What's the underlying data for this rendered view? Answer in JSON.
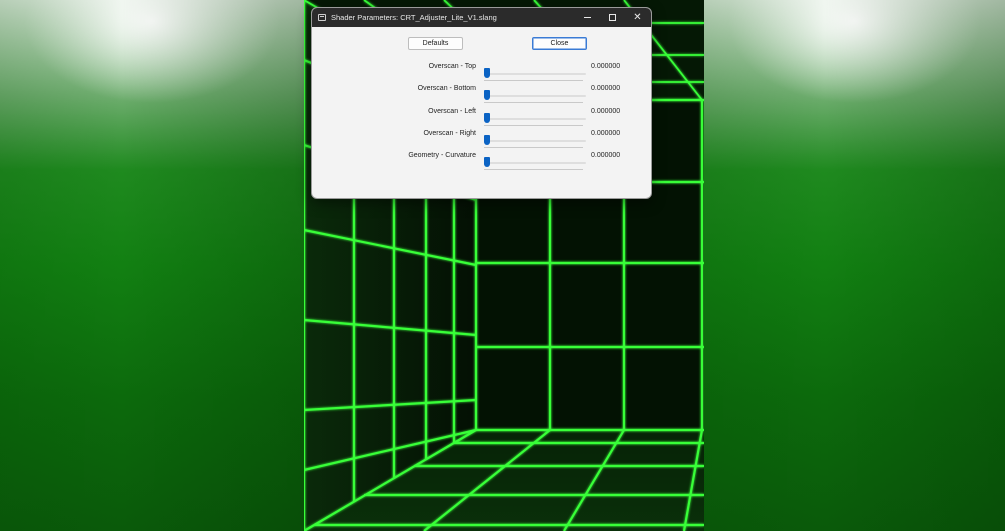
{
  "dialog": {
    "title": "Shader Parameters: CRT_Adjuster_Lite_V1.slang",
    "buttons": {
      "defaults": "Defaults",
      "close": "Close"
    },
    "window_controls": {
      "minimize": "minimize-icon",
      "maximize": "maximize-icon",
      "close": "close-icon",
      "close_glyph": "✕"
    },
    "accent_color": "#0b63c4",
    "params": [
      {
        "label": "Overscan - Top",
        "value": "0.000000",
        "level": 0
      },
      {
        "label": "Overscan - Bottom",
        "value": "0.000000",
        "level": 0
      },
      {
        "label": "Overscan - Left",
        "value": "0.000000",
        "level": 0
      },
      {
        "label": "Overscan - Right",
        "value": "0.000000",
        "level": 0
      },
      {
        "label": "Geometry - Curvature",
        "value": "0.000000",
        "level": 0
      }
    ]
  },
  "background": {
    "grid_color": "#39ff39",
    "side_color": "#128012"
  }
}
